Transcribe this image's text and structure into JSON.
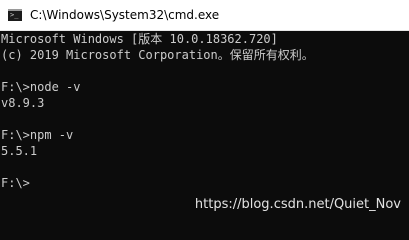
{
  "window": {
    "title": "C:\\Windows\\System32\\cmd.exe",
    "icon": "cmd-icon"
  },
  "console": {
    "lines": [
      "Microsoft Windows [版本 10.0.18362.720]",
      "(c) 2019 Microsoft Corporation。保留所有权利。",
      "",
      "F:\\>node -v",
      "v8.9.3",
      "",
      "F:\\>npm -v",
      "5.5.1",
      "",
      "F:\\>"
    ]
  },
  "watermark": "https://blog.csdn.net/Quiet_Nov",
  "colors": {
    "titlebar_bg": "#ffffff",
    "console_bg": "#0c0c0c",
    "console_text": "#cccccc"
  }
}
